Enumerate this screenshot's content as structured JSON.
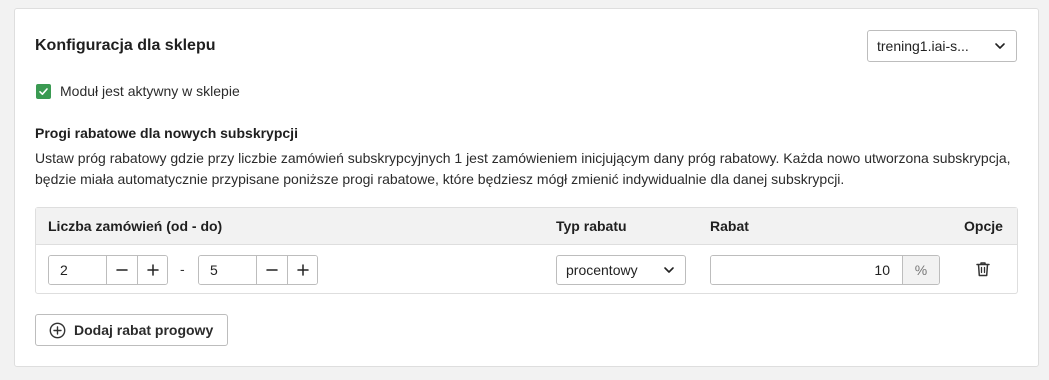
{
  "header": {
    "title": "Konfiguracja dla sklepu",
    "store_select": {
      "value": "trening1.iai-s..."
    }
  },
  "module": {
    "active_label": "Moduł jest aktywny w sklepie",
    "checked": true
  },
  "section": {
    "title": "Progi rabatowe dla nowych subskrypcji",
    "description": "Ustaw próg rabatowy gdzie przy liczbie zamówień subskrypcyjnych 1 jest zamówieniem inicjującym dany próg rabatowy. Każda nowo utworzona subskrypcja, będzie miała automatycznie przypisane poniższe progi rabatowe, które będziesz mógł zmienić indywidualnie dla danej subskrypcji."
  },
  "table": {
    "columns": {
      "orders": "Liczba zamówień (od - do)",
      "type": "Typ rabatu",
      "discount": "Rabat",
      "options": "Opcje"
    },
    "rows": [
      {
        "from": "2",
        "separator": "-",
        "to": "5",
        "type": "procentowy",
        "discount": "10",
        "unit": "%"
      }
    ]
  },
  "actions": {
    "add_label": "Dodaj rabat progowy"
  },
  "colors": {
    "accent_green": "#3a9a52",
    "border": "#bdbdbd",
    "header_bg": "#f2f2f2"
  },
  "icons": {
    "chevron": "chevron-down-icon",
    "check": "check-icon",
    "minus": "minus-icon",
    "plus": "plus-icon",
    "trash": "trash-icon",
    "add": "plus-circle-icon"
  }
}
